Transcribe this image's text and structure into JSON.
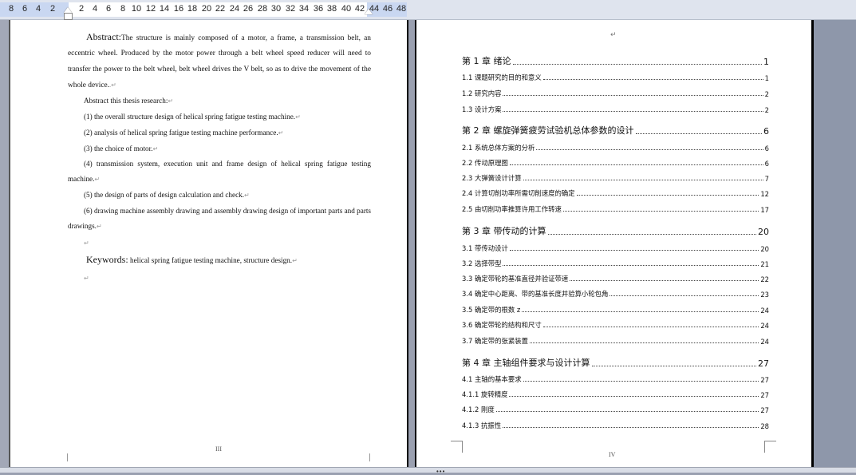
{
  "ruler": {
    "ticks": [
      "8",
      "6",
      "4",
      "2",
      "2",
      "4",
      "6",
      "8",
      "10",
      "12",
      "14",
      "16",
      "18",
      "20",
      "22",
      "24",
      "26",
      "28",
      "30",
      "32",
      "34",
      "36",
      "38",
      "40",
      "42",
      "44",
      "46",
      "48"
    ]
  },
  "left_page": {
    "abstract_heading": "Abstract:",
    "abstract_body": "The structure is mainly composed of a motor, a frame, a transmission belt, an eccentric wheel. Produced by the motor power through a belt wheel speed reducer will need to transfer the power to the belt wheel, belt wheel drives the V belt, so as to drive the movement of the whole device.",
    "research_intro": "Abstract this thesis research:",
    "items": [
      "(1) the overall structure design of helical spring fatigue testing machine.",
      "(2) analysis of helical spring fatigue testing machine performance.",
      "(3) the choice of motor.",
      "(4) transmission system, execution unit and frame design of helical spring fatigue testing machine.",
      "(5) the design of parts of design calculation and check.",
      "(6) drawing machine assembly drawing and assembly drawing design of important parts and parts drawings."
    ],
    "keywords_heading": "Keywords:",
    "keywords_body": "helical spring fatigue testing machine, structure design.",
    "page_number": "III"
  },
  "right_page": {
    "page_number": "IV",
    "toc": [
      {
        "label": "第 1 章  绪论",
        "page": "1",
        "level": "chapter"
      },
      {
        "label": "1.1 课题研究的目的和意义",
        "page": "1",
        "level": "section"
      },
      {
        "label": "1.2 研究内容",
        "page": "2",
        "level": "section"
      },
      {
        "label": "1.3 设计方案",
        "page": "2",
        "level": "section"
      },
      {
        "label": "第 2 章  螺旋弹簧疲劳试验机总体参数的设计",
        "page": "6",
        "level": "chapter"
      },
      {
        "label": "2.1  系统总体方案的分析",
        "page": "6",
        "level": "section"
      },
      {
        "label": "2.2 传动原理图",
        "page": "6",
        "level": "section"
      },
      {
        "label": "2.3 大弹簧设计计算",
        "page": "7",
        "level": "section"
      },
      {
        "label": "2.4 计算切削功率所需切削速度的确定",
        "page": "12",
        "level": "section"
      },
      {
        "label": "2.5  由切削功率推算许用工作转速",
        "page": "17",
        "level": "section"
      },
      {
        "label": "第 3 章   带传动的计算",
        "page": "20",
        "level": "chapter"
      },
      {
        "label": "3.1  带传动设计",
        "page": "20",
        "level": "section"
      },
      {
        "label": "3.2 选择带型",
        "page": "21",
        "level": "section"
      },
      {
        "label": "3.3 确定带轮的基准直径并验证带速",
        "page": "22",
        "level": "section"
      },
      {
        "label": "3.4 确定中心距离、带的基准长度并验算小轮包角",
        "page": "23",
        "level": "section"
      },
      {
        "label": "3.5 确定带的根数 z",
        "page": "24",
        "level": "section"
      },
      {
        "label": "3.6 确定带轮的结构和尺寸",
        "page": "24",
        "level": "section"
      },
      {
        "label": "3.7 确定带的张紧装置",
        "page": "24",
        "level": "section"
      },
      {
        "label": "第 4 章   主轴组件要求与设计计算",
        "page": "27",
        "level": "chapter"
      },
      {
        "label": "4.1  主轴的基本要求",
        "page": "27",
        "level": "section"
      },
      {
        "label": "4.1.1    旋转精度",
        "page": "27",
        "level": "section"
      },
      {
        "label": "4.1.2    刚度",
        "page": "27",
        "level": "section"
      },
      {
        "label": "4.1.3    抗振性",
        "page": "28",
        "level": "section"
      }
    ]
  }
}
